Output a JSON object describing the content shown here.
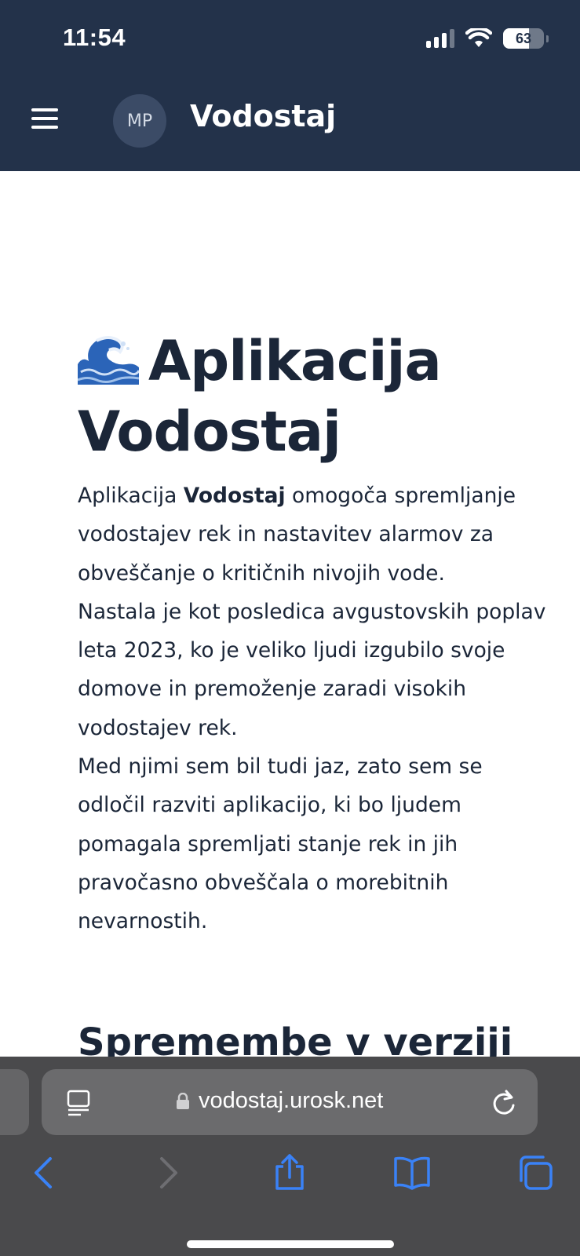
{
  "status_bar": {
    "time": "11:54",
    "battery": "63"
  },
  "header": {
    "avatar_initials": "MP",
    "title": "Vodostaj"
  },
  "content": {
    "heading": "Aplikacija Vodostaj",
    "para_prefix": "Aplikacija ",
    "para_bold": "Vodostaj",
    "para_rest": " omogoča spremljanje vodostajev rek in nastavitev alarmov za obveščanje o kritičnih nivojih vode.",
    "para2": "Nastala je kot posledica avgustovskih poplav leta 2023, ko je veliko ljudi izgubilo svoje domove in premoženje zaradi visokih vodostajev rek.",
    "para3": "Med njimi sem bil tudi jaz, zato sem se odločil razviti aplikacijo, ki bo ljudem pomagala spremljati stanje rek in jih pravočasno obveščala o morebitnih nevarnostih.",
    "subheading": "Spremembe v verziji"
  },
  "browser": {
    "url": "vodostaj.urosk.net"
  },
  "colors": {
    "header_bg": "#23324a",
    "accent_blue": "#3a82f7",
    "text": "#1b2638"
  }
}
